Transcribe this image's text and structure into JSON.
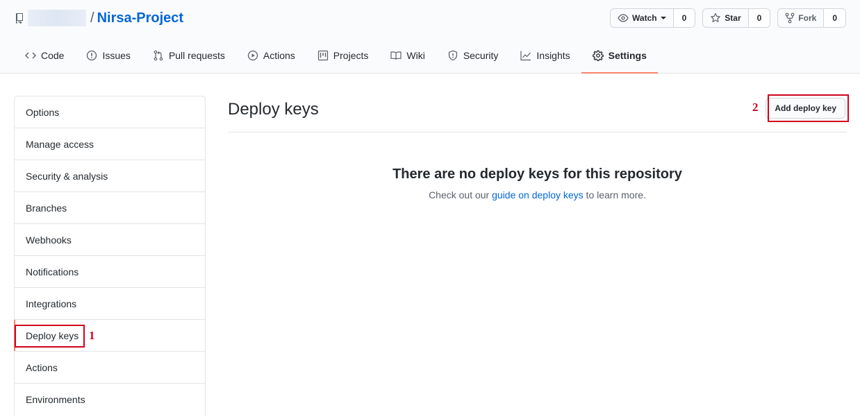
{
  "repo": {
    "owner": "",
    "separator": "/",
    "name": "Nirsa-Project"
  },
  "actions": {
    "watch_label": "Watch",
    "watch_count": "0",
    "star_label": "Star",
    "star_count": "0",
    "fork_label": "Fork",
    "fork_count": "0"
  },
  "nav": {
    "tabs": [
      {
        "label": "Code",
        "icon": "code-icon"
      },
      {
        "label": "Issues",
        "icon": "issue-icon"
      },
      {
        "label": "Pull requests",
        "icon": "pull-request-icon"
      },
      {
        "label": "Actions",
        "icon": "play-icon"
      },
      {
        "label": "Projects",
        "icon": "project-icon"
      },
      {
        "label": "Wiki",
        "icon": "book-icon"
      },
      {
        "label": "Security",
        "icon": "shield-icon"
      },
      {
        "label": "Insights",
        "icon": "graph-icon"
      },
      {
        "label": "Settings",
        "icon": "gear-icon",
        "selected": true
      }
    ]
  },
  "sidebar": {
    "items": [
      {
        "label": "Options"
      },
      {
        "label": "Manage access"
      },
      {
        "label": "Security & analysis"
      },
      {
        "label": "Branches"
      },
      {
        "label": "Webhooks"
      },
      {
        "label": "Notifications"
      },
      {
        "label": "Integrations"
      },
      {
        "label": "Deploy keys",
        "selected": true
      },
      {
        "label": "Actions"
      },
      {
        "label": "Environments"
      }
    ]
  },
  "main": {
    "title": "Deploy keys",
    "add_button_label": "Add deploy key",
    "blank_title": "There are no deploy keys for this repository",
    "blank_text_before": "Check out our ",
    "blank_link": "guide on deploy keys",
    "blank_text_after": " to learn more."
  },
  "annotations": {
    "step1": "1",
    "step2": "2",
    "color": "#d0021b"
  },
  "colors": {
    "link": "#0366d6",
    "tab_underline": "#f9826c"
  }
}
